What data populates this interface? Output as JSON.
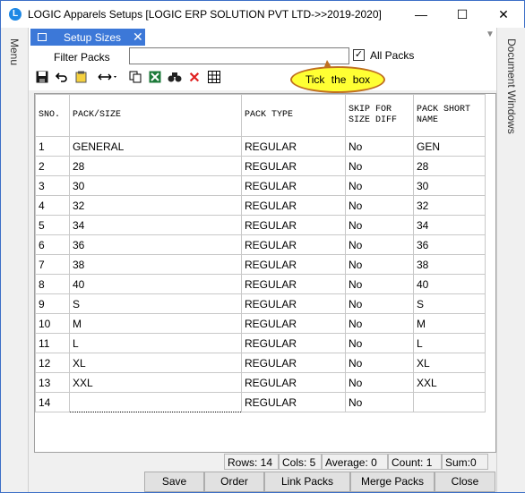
{
  "window": {
    "title": "LOGIC Apparels Setups  [LOGIC ERP SOLUTION PVT LTD->>2019-2020]",
    "icon": "logic-app-icon",
    "minimize": "—",
    "maximize": "☐",
    "close": "✕"
  },
  "side_menu_label": "Menu",
  "right_panel_label": "Document Windows",
  "tab": {
    "label": "Setup Sizes",
    "close": "✕"
  },
  "filter": {
    "label": "Filter Packs",
    "value": "",
    "placeholder": "",
    "checkbox_checked": true,
    "checkbox_label": "All Packs"
  },
  "callout": "Tick the box",
  "toolbar": {
    "icons": [
      "save-icon",
      "undo-icon",
      "notes-icon",
      "column-width-icon",
      "copy-icon",
      "excel-export-icon",
      "find-icon",
      "delete-icon",
      "grid-icon"
    ]
  },
  "grid": {
    "columns": [
      "SNO.",
      "PACK/SIZE",
      "PACK TYPE",
      "SKIP FOR SIZE DIFF",
      "PACK SHORT NAME"
    ],
    "rows": [
      [
        "1",
        "GENERAL",
        "REGULAR",
        "No",
        "GEN"
      ],
      [
        "2",
        "28",
        "REGULAR",
        "No",
        "28"
      ],
      [
        "3",
        "30",
        "REGULAR",
        "No",
        "30"
      ],
      [
        "4",
        "32",
        "REGULAR",
        "No",
        "32"
      ],
      [
        "5",
        "34",
        "REGULAR",
        "No",
        "34"
      ],
      [
        "6",
        "36",
        "REGULAR",
        "No",
        "36"
      ],
      [
        "7",
        "38",
        "REGULAR",
        "No",
        "38"
      ],
      [
        "8",
        "40",
        "REGULAR",
        "No",
        "40"
      ],
      [
        "9",
        "S",
        "REGULAR",
        "No",
        "S"
      ],
      [
        "10",
        "M",
        "REGULAR",
        "No",
        "M"
      ],
      [
        "11",
        "L",
        "REGULAR",
        "No",
        "L"
      ],
      [
        "12",
        "XL",
        "REGULAR",
        "No",
        "XL"
      ],
      [
        "13",
        "XXL",
        "REGULAR",
        "No",
        "XXL"
      ],
      [
        "14",
        "",
        "REGULAR",
        "No",
        ""
      ]
    ]
  },
  "status": {
    "rows": "Rows: 14",
    "cols": "Cols: 5",
    "average": "Average: 0",
    "count": "Count: 1",
    "sum": "Sum:0"
  },
  "buttons": {
    "save": "Save",
    "order": "Order",
    "link_packs": "Link Packs",
    "merge_packs": "Merge Packs",
    "close": "Close"
  },
  "colors": {
    "tab_active": "#3c78d8",
    "callout_fill": "#ffff33",
    "callout_border": "#c07020",
    "delete_icon": "#e02020",
    "excel_icon": "#1d7a3a"
  }
}
